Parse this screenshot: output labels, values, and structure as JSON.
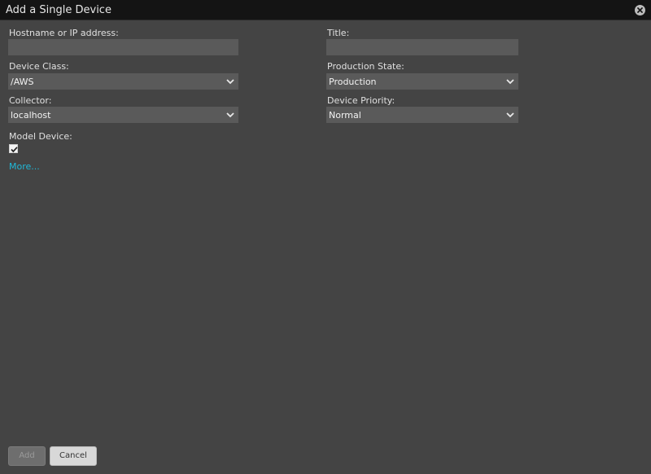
{
  "dialog": {
    "title": "Add a Single Device"
  },
  "form": {
    "hostname": {
      "label": "Hostname or IP address:",
      "value": ""
    },
    "title": {
      "label": "Title:",
      "value": ""
    },
    "device_class": {
      "label": "Device Class:",
      "value": "/AWS"
    },
    "production_state": {
      "label": "Production State:",
      "value": "Production"
    },
    "collector": {
      "label": "Collector:",
      "value": "localhost"
    },
    "device_priority": {
      "label": "Device Priority:",
      "value": "Normal"
    },
    "model_device": {
      "label": "Model Device:",
      "checked": true
    },
    "more_link": "More..."
  },
  "buttons": {
    "add": "Add",
    "cancel": "Cancel"
  },
  "colors": {
    "background": "#444444",
    "titlebar": "#141414",
    "field": "#5a5a5a",
    "link": "#20b8d8"
  },
  "icons": {
    "close": "close-circle-icon",
    "dropdown": "chevron-down-icon",
    "check": "checkmark-icon"
  }
}
